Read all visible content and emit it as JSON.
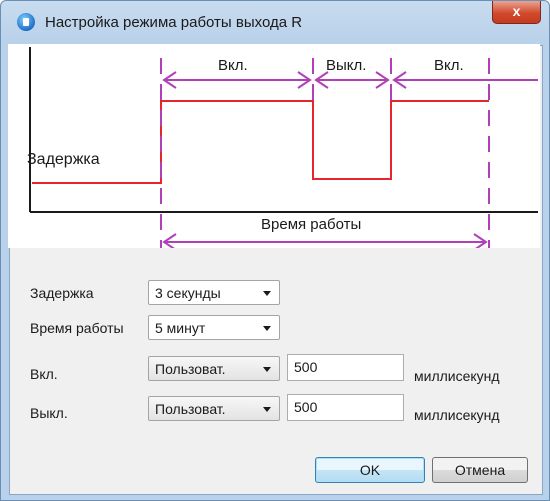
{
  "window": {
    "title": "Настройка режима работы выхода R",
    "close_symbol": "x"
  },
  "diagram": {
    "label_delay": "Задержка",
    "label_on_1": "Вкл.",
    "label_off": "Выкл.",
    "label_on_2": "Вкл.",
    "label_work_time": "Время работы",
    "signal_color": "#e8242d",
    "marker_color": "#b040b8"
  },
  "form": {
    "delay": {
      "label": "Задержка",
      "value": "3 секунды"
    },
    "work_time": {
      "label": "Время работы",
      "value": "5 минут"
    },
    "on": {
      "label": "Вкл.",
      "mode": "Пользоват.",
      "value": "500",
      "unit": "миллисекунд"
    },
    "off": {
      "label": "Выкл.",
      "mode": "Пользоват.",
      "value": "500",
      "unit": "миллисекунд"
    }
  },
  "buttons": {
    "ok": "OK",
    "cancel": "Отмена"
  }
}
